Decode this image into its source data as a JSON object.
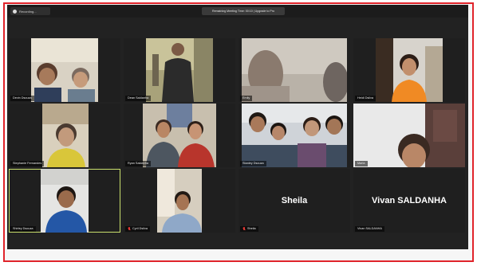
{
  "window": {
    "recording_label": "Recording...",
    "banner_text": "Remaining Meeting Time: 00:10 | Upgrade to Pro"
  },
  "participants": [
    {
      "name": "Devin Dsouza",
      "muted": false
    },
    {
      "name": "Dean Saldanha",
      "muted": false
    },
    {
      "name": "Emily",
      "muted": false
    },
    {
      "name": "Heidi Dsilva",
      "muted": false
    },
    {
      "name": "Stephanie Fernandes",
      "muted": false
    },
    {
      "name": "Ryan Saldanha",
      "muted": false
    },
    {
      "name": "Stanley Dsouza",
      "muted": false
    },
    {
      "name": "Maria",
      "muted": false
    },
    {
      "name": "Shirley Dsouza",
      "muted": false,
      "active_speaker": true
    },
    {
      "name": "Cyril Dsilva",
      "muted": true
    },
    {
      "name": "Sheila",
      "muted": true,
      "video_off": true
    },
    {
      "name": "Vivan SALDANHA",
      "muted": false,
      "video_off": true
    }
  ],
  "colors": {
    "frame_border": "#e0242b",
    "active_speaker_border": "#c9df6c",
    "muted_icon": "#e53935"
  }
}
